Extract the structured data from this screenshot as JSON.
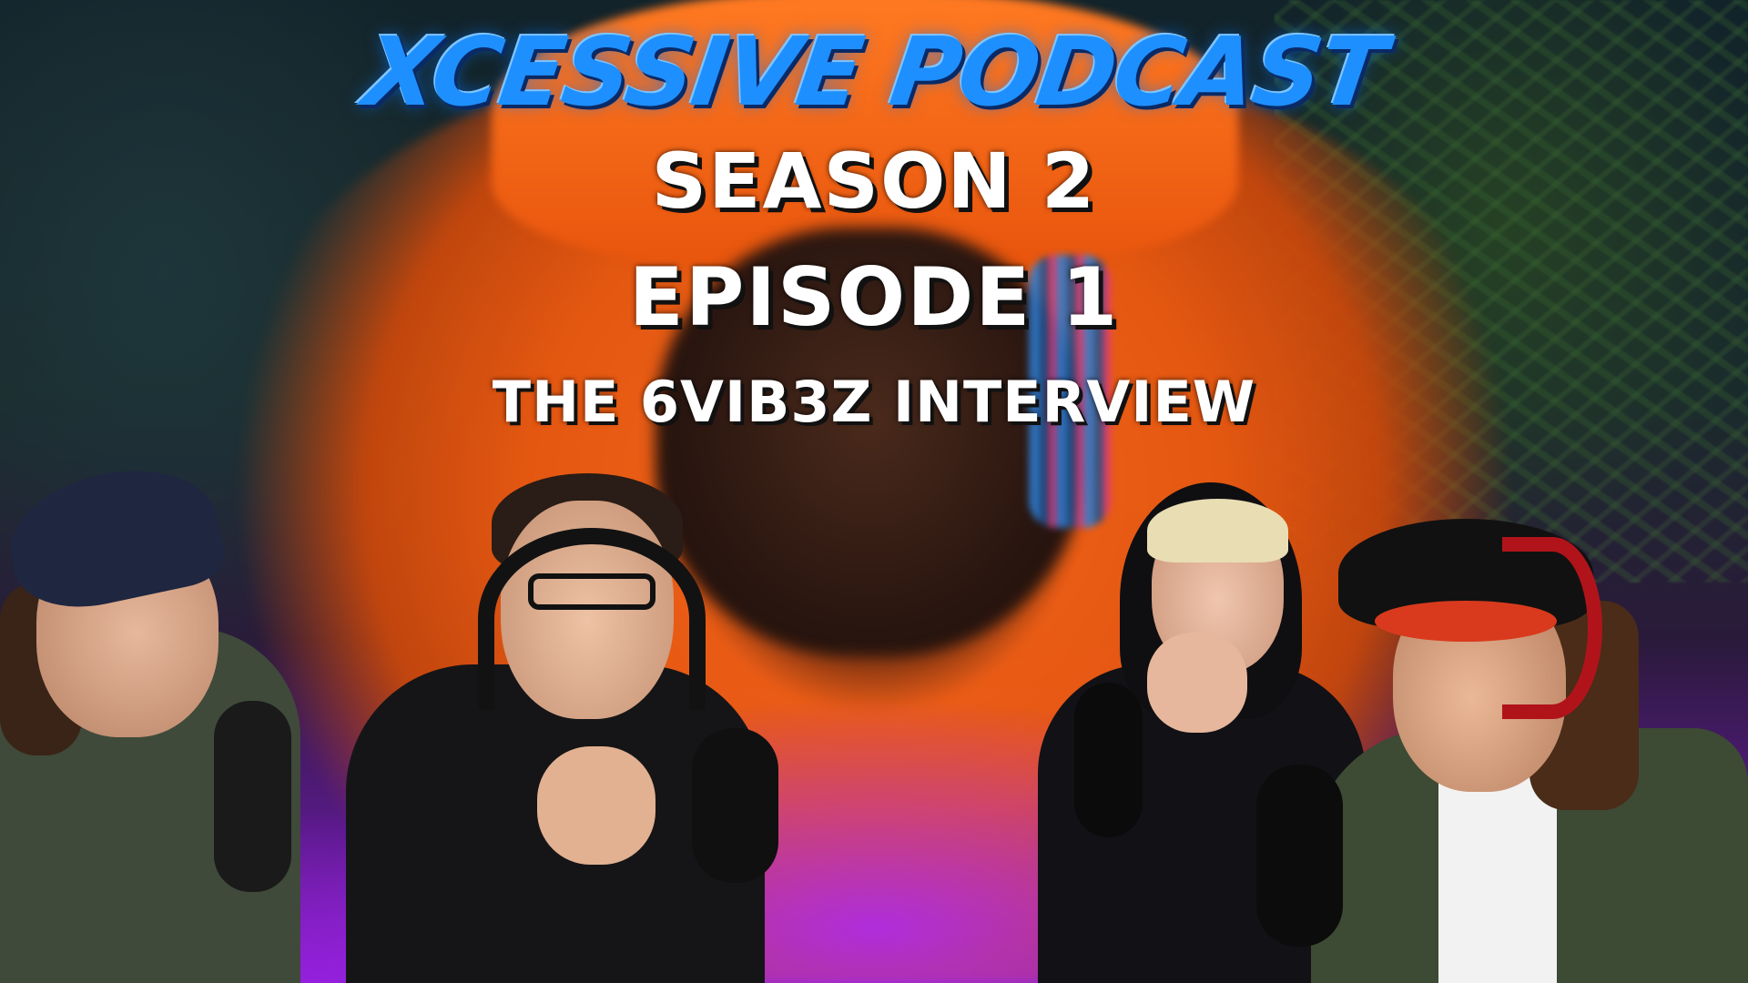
{
  "thumbnail": {
    "podcast_name": "XCESSIVE PODCAST",
    "season": "SEASON 2",
    "episode": "EPISODE 1",
    "episode_title": "THE 6VIB3Z INTERVIEW"
  },
  "colors": {
    "podcast_name": "#1e8fff",
    "heading_text": "#ffffff",
    "hoodie": "#ff6a1a",
    "glow": "#a028ff"
  }
}
